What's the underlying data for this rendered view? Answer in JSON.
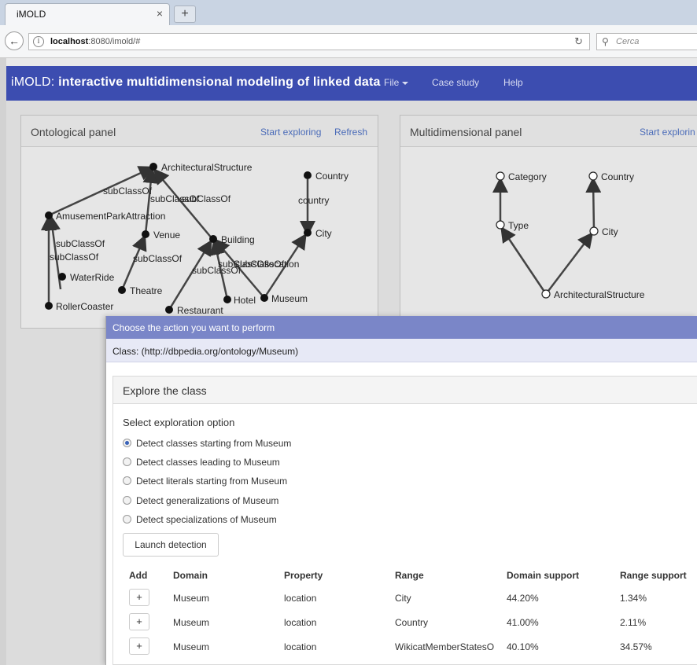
{
  "browser": {
    "tab_title": "iMOLD",
    "tab_close": "×",
    "new_tab": "+",
    "url_host": "localhost",
    "url_rest": ":8080/imold/#",
    "search_placeholder": "Cerca"
  },
  "navbar": {
    "brand_pre": "iMOLD: ",
    "brand_main": "interactive multidimensional modeling of linked data",
    "menu": [
      "File",
      "Case study",
      "Help"
    ]
  },
  "ontological_panel": {
    "title": "Ontological panel",
    "start_link": "Start exploring",
    "refresh_link": "Refresh",
    "nodes": [
      "ArchitecturalStructure",
      "Country",
      "AmusementParkAttraction",
      "Venue",
      "Building",
      "City",
      "WaterRide",
      "Theatre",
      "Hotel",
      "Museum",
      "Restaurant",
      "RollerCoaster"
    ],
    "edges": [
      "subClassOf",
      "subClassOf",
      "subClassOf",
      "country",
      "subClassOf",
      "subClassOf",
      "subClassOf",
      "subClassOf",
      "subClassOf",
      "subClassOf",
      "location"
    ]
  },
  "multidimensional_panel": {
    "title": "Multidimensional panel",
    "start_link": "Start explorin",
    "nodes": [
      "Category",
      "Country",
      "Type",
      "City",
      "ArchitecturalStructure"
    ]
  },
  "modal": {
    "header": "Choose the action you want to perform",
    "class_label": "Class: (http://dbpedia.org/ontology/Museum)",
    "explore_title": "Explore the class",
    "select_label": "Select exploration option",
    "options": [
      {
        "label": "Detect classes starting from Museum",
        "selected": true
      },
      {
        "label": "Detect classes leading to Museum",
        "selected": false
      },
      {
        "label": "Detect literals starting from Museum",
        "selected": false
      },
      {
        "label": "Detect generalizations of Museum",
        "selected": false
      },
      {
        "label": "Detect specializations of Museum",
        "selected": false
      }
    ],
    "launch_button": "Launch detection",
    "table_headers": [
      "Add",
      "Domain",
      "Property",
      "Range",
      "Domain support",
      "Range support"
    ],
    "rows": [
      {
        "add": "+",
        "domain": "Museum",
        "property": "location",
        "range": "City",
        "domain_support": "44.20%",
        "range_support": "1.34%"
      },
      {
        "add": "+",
        "domain": "Museum",
        "property": "location",
        "range": "Country",
        "domain_support": "41.00%",
        "range_support": "2.11%"
      },
      {
        "add": "+",
        "domain": "Museum",
        "property": "location",
        "range": "WikicatMemberStatesO",
        "domain_support": "40.10%",
        "range_support": "34.57%"
      }
    ]
  },
  "colors": {
    "navbar": "#3c4db0",
    "modal_header": "#7a86c8",
    "link": "#4a6bb8"
  }
}
